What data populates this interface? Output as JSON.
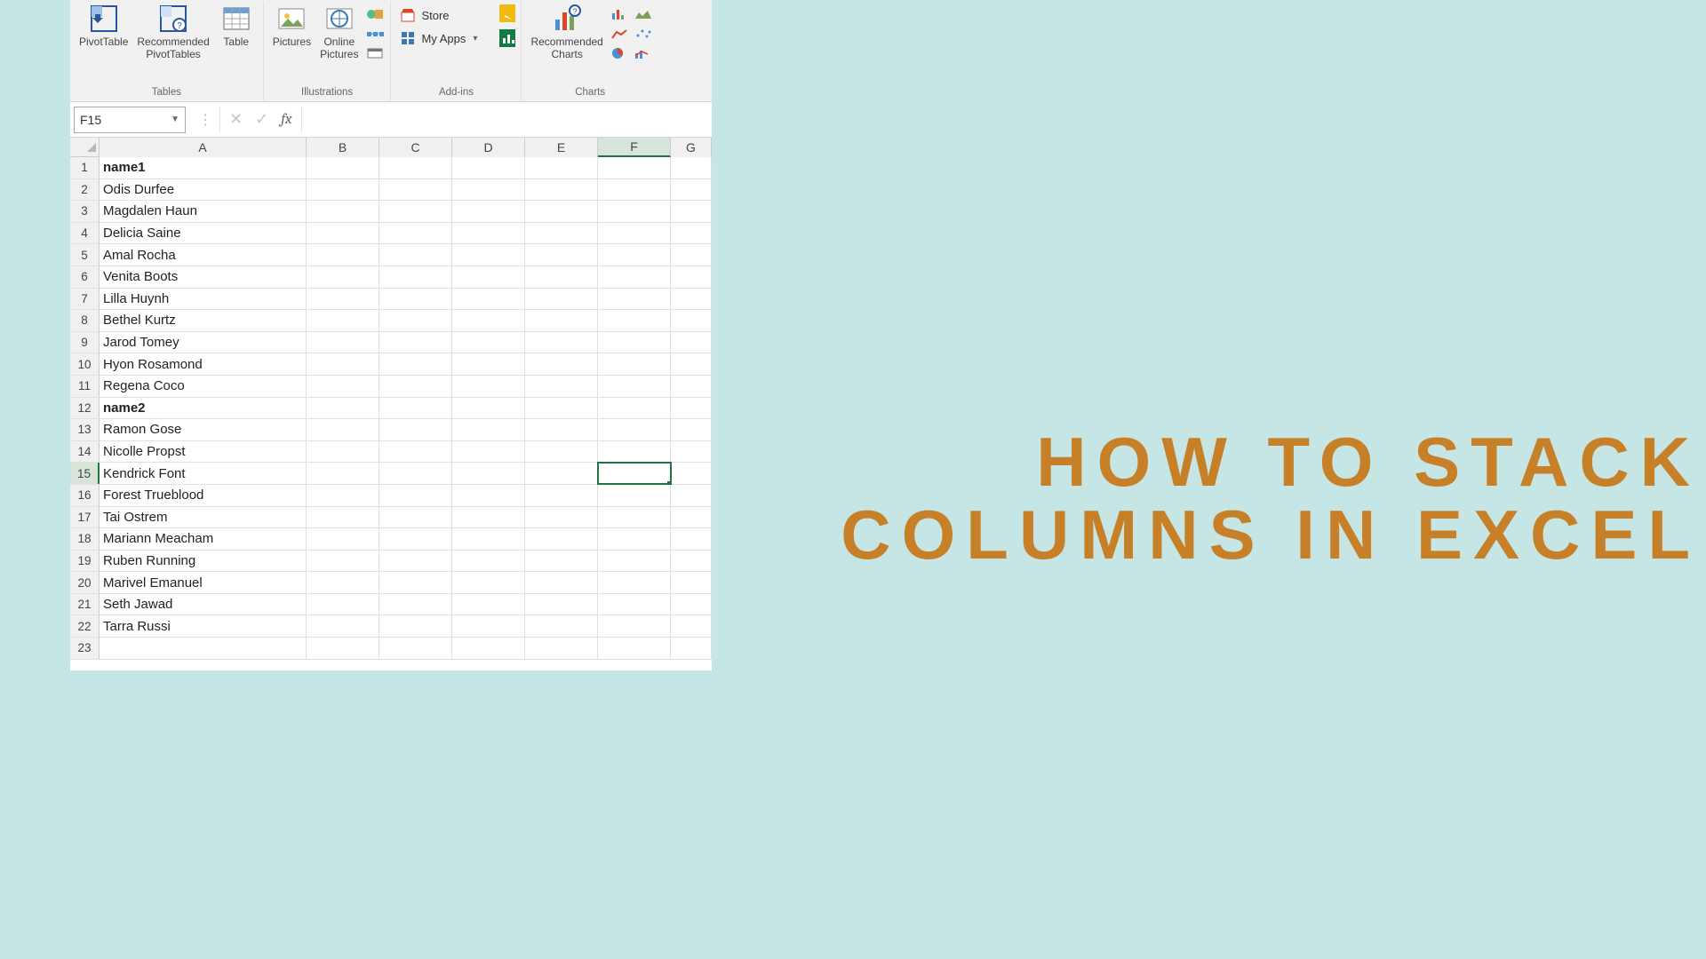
{
  "ribbon": {
    "groups": {
      "tables": {
        "label": "Tables",
        "pivottable": "PivotTable",
        "recommended_pt1": "Recommended",
        "recommended_pt2": "PivotTables",
        "table": "Table"
      },
      "illustrations": {
        "label": "Illustrations",
        "pictures": "Pictures",
        "online_pics1": "Online",
        "online_pics2": "Pictures"
      },
      "addins": {
        "label": "Add-ins",
        "store": "Store",
        "myapps": "My Apps"
      },
      "charts": {
        "label": "Charts",
        "recommended_charts1": "Recommended",
        "recommended_charts2": "Charts"
      }
    }
  },
  "formula_bar": {
    "name_box": "F15",
    "fx": "fx",
    "value": ""
  },
  "columns": [
    "A",
    "B",
    "C",
    "D",
    "E",
    "F",
    "G"
  ],
  "active_column_index": 5,
  "active_row_index": 14,
  "rows_count": 23,
  "cells": {
    "1": {
      "A": "name1",
      "bold": true
    },
    "2": {
      "A": "Odis Durfee"
    },
    "3": {
      "A": "Magdalen Haun"
    },
    "4": {
      "A": "Delicia Saine"
    },
    "5": {
      "A": "Amal Rocha"
    },
    "6": {
      "A": "Venita Boots"
    },
    "7": {
      "A": "Lilla Huynh"
    },
    "8": {
      "A": "Bethel Kurtz"
    },
    "9": {
      "A": "Jarod Tomey"
    },
    "10": {
      "A": "Hyon Rosamond"
    },
    "11": {
      "A": "Regena Coco"
    },
    "12": {
      "A": "name2",
      "bold": true
    },
    "13": {
      "A": "Ramon Gose"
    },
    "14": {
      "A": "Nicolle Propst"
    },
    "15": {
      "A": "Kendrick Font"
    },
    "16": {
      "A": "Forest Trueblood"
    },
    "17": {
      "A": "Tai Ostrem"
    },
    "18": {
      "A": "Mariann Meacham"
    },
    "19": {
      "A": "Ruben Running"
    },
    "20": {
      "A": "Marivel Emanuel"
    },
    "21": {
      "A": "Seth Jawad"
    },
    "22": {
      "A": "Tarra Russi"
    },
    "23": {
      "A": ""
    }
  },
  "overlay": {
    "line1": "HOW TO STACK",
    "line2": "COLUMNS IN EXCEL"
  }
}
